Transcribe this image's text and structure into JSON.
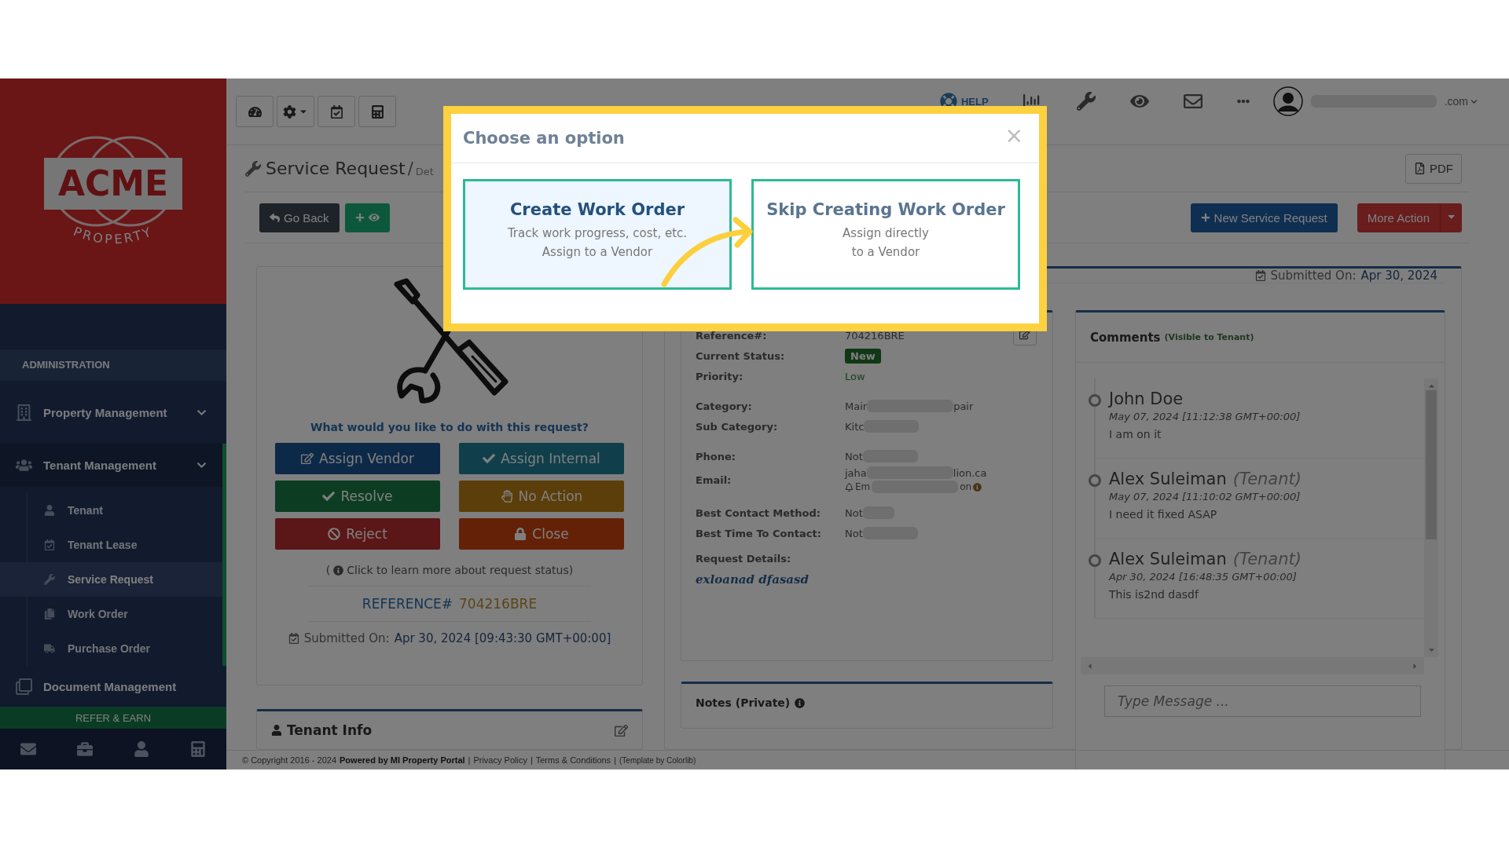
{
  "sidebar": {
    "logo": {
      "name": "ACME",
      "tagline": "PROPERTY"
    },
    "section": "ADMINISTRATION",
    "items": [
      {
        "label": "Property Management",
        "selected": false
      },
      {
        "label": "Tenant Management",
        "selected": true,
        "children": [
          {
            "label": "Tenant",
            "selected": false
          },
          {
            "label": "Tenant Lease",
            "selected": false
          },
          {
            "label": "Service Request",
            "selected": true
          },
          {
            "label": "Work Order",
            "selected": false
          },
          {
            "label": "Purchase Order",
            "selected": false
          }
        ]
      },
      {
        "label": "Document Management",
        "selected": false
      }
    ],
    "promo": "REFER & EARN"
  },
  "topbar": {
    "help": "HELP",
    "user_email_end": ".com"
  },
  "page": {
    "title": "Service Request",
    "separator": "/",
    "crumb": "Det",
    "pdf": "PDF",
    "back": "Go Back",
    "new_request": "New Service Request",
    "more_action": "More Action"
  },
  "request_card": {
    "question": "What would you like to do with this request?",
    "actions": [
      {
        "label": "Assign Vendor",
        "kind": "primary"
      },
      {
        "label": "Assign Internal",
        "kind": "info"
      },
      {
        "label": "Resolve",
        "kind": "success"
      },
      {
        "label": "No Action",
        "kind": "warning"
      },
      {
        "label": "Reject",
        "kind": "danger"
      },
      {
        "label": "Close",
        "kind": "closing"
      }
    ],
    "status_help": {
      "open": "(",
      "text": "Click to learn more about request status)"
    },
    "reference": {
      "label": "REFERENCE#",
      "value": "704216BRE"
    },
    "submitted": {
      "label": "Submitted On:",
      "value": "Apr 30, 2024 [09:43:30 GMT+00:00]"
    }
  },
  "tenant_info": {
    "title": "Tenant Info"
  },
  "submitted_summary": {
    "label": "Submitted On:",
    "value": "Apr 30, 2024"
  },
  "details": {
    "groups": [
      [
        {
          "label": "Reference#:",
          "value": "704216BRE",
          "kind": "text"
        },
        {
          "label": "Current Status:",
          "value": "New",
          "kind": "badge"
        },
        {
          "label": "Priority:",
          "value": "Low",
          "kind": "accent"
        }
      ],
      [
        {
          "label": "Category:",
          "value": "Mair",
          "value_end": "pair",
          "kind": "text",
          "redacted": true
        },
        {
          "label": "Sub Category:",
          "value": "Kitc",
          "kind": "text",
          "redacted": true
        }
      ],
      [
        {
          "label": "Phone:",
          "value": "Not",
          "kind": "text",
          "redacted": true
        },
        {
          "label": "Email:",
          "value": "jaha",
          "value_end": "lion.ca",
          "kind": "text",
          "redacted": true,
          "note": {
            "start": "Em",
            "end": "on"
          }
        }
      ],
      [
        {
          "label": "Best Contact Method:",
          "value": "Not",
          "kind": "text",
          "redacted": true
        },
        {
          "label": "Best Time To Contact:",
          "value": "Not",
          "kind": "text",
          "redacted": true
        }
      ]
    ],
    "request_details": {
      "label": "Request Details:",
      "value": "exloanad dfasasd"
    }
  },
  "notes": {
    "title": "Notes (Private)"
  },
  "comments": {
    "title": "Comments",
    "subtitle": "(Visible to Tenant)",
    "items": [
      {
        "name": "John Doe",
        "time": "May 07, 2024 [11:12:38 GMT+00:00]",
        "text": "I am on it"
      },
      {
        "name": "Alex Suleiman",
        "role": "(Tenant)",
        "time": "May 07, 2024 [11:10:02 GMT+00:00]",
        "text": "I need it fixed ASAP"
      },
      {
        "name": "Alex Suleiman",
        "role": "(Tenant)",
        "time": "Apr 30, 2024 [16:48:35 GMT+00:00]",
        "text": "This is2nd dasdf"
      }
    ],
    "placeholder": "Type Message ..."
  },
  "footer": {
    "copyright": "© Copyright 2016 - 2024",
    "powered": "Powered by MI Property Portal",
    "separator": "|",
    "links": [
      "Privacy Policy",
      "Terms & Conditions"
    ],
    "credit": "(Template by Colorlib)"
  },
  "modal": {
    "title": "Choose an option",
    "close": "×",
    "options": [
      {
        "title": "Create Work Order",
        "lines": [
          "Track work progress, cost, etc.",
          "Assign to a Vendor"
        ],
        "selected": true
      },
      {
        "title": "Skip Creating Work Order",
        "lines": [
          "Assign directly",
          "to a Vendor"
        ],
        "selected": false
      }
    ]
  }
}
